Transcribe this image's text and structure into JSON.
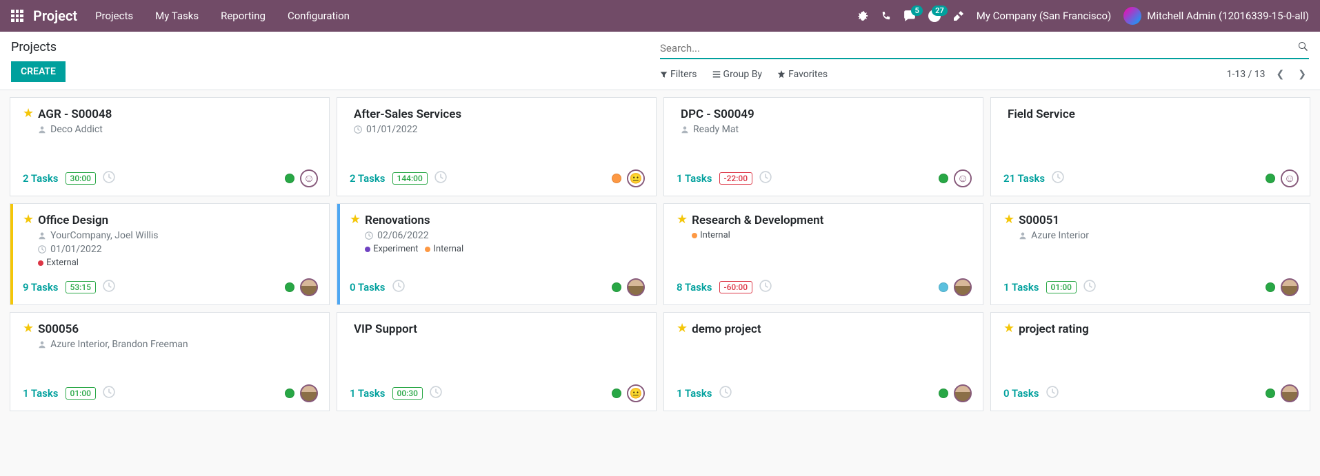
{
  "header": {
    "brand": "Project",
    "nav": [
      "Projects",
      "My Tasks",
      "Reporting",
      "Configuration"
    ],
    "chat_badge": "5",
    "activity_badge": "27",
    "company": "My Company (San Francisco)",
    "user": "Mitchell Admin (12016339-15-0-all)"
  },
  "control": {
    "breadcrumb": "Projects",
    "create_label": "CREATE",
    "search_placeholder": "Search...",
    "filters_label": "Filters",
    "groupby_label": "Group By",
    "favorites_label": "Favorites",
    "pager": "1-13 / 13"
  },
  "tag_colors": {
    "External": "#dc3545",
    "Experiment": "#6f42c1",
    "Internal": "#fd9843"
  },
  "cards": [
    {
      "star": true,
      "stripe": null,
      "title": "AGR - S00048",
      "partner": "Deco Addict",
      "date": null,
      "tags": [],
      "tasks": "2 Tasks",
      "pill": "30:00",
      "pill_color": "green",
      "status": "green",
      "avatar": "smiley"
    },
    {
      "star": false,
      "stripe": null,
      "title": "After-Sales Services",
      "partner": null,
      "date": "01/01/2022",
      "tags": [],
      "tasks": "2 Tasks",
      "pill": "144:00",
      "pill_color": "green",
      "status": "orange",
      "avatar": "neutral"
    },
    {
      "star": false,
      "stripe": null,
      "title": "DPC - S00049",
      "partner": "Ready Mat",
      "date": null,
      "tags": [],
      "tasks": "1 Tasks",
      "pill": "-22:00",
      "pill_color": "red",
      "status": "green",
      "avatar": "smiley"
    },
    {
      "star": false,
      "stripe": null,
      "title": "Field Service",
      "partner": null,
      "date": null,
      "tags": [],
      "tasks": "21 Tasks",
      "pill": null,
      "pill_color": null,
      "status": "green",
      "avatar": "smiley"
    },
    {
      "star": true,
      "stripe": "yellow",
      "title": "Office Design",
      "partner": "YourCompany, Joel Willis",
      "date": "01/01/2022",
      "tags": [
        "External"
      ],
      "tasks": "9 Tasks",
      "pill": "53:15",
      "pill_color": "green",
      "status": "green",
      "avatar": "face"
    },
    {
      "star": true,
      "stripe": "blue",
      "title": "Renovations",
      "partner": null,
      "date": "02/06/2022",
      "tags": [
        "Experiment",
        "Internal"
      ],
      "tasks": "0 Tasks",
      "pill": null,
      "pill_color": null,
      "status": "green",
      "avatar": "face"
    },
    {
      "star": true,
      "stripe": null,
      "title": "Research & Development",
      "partner": null,
      "date": null,
      "tags": [
        "Internal"
      ],
      "tasks": "8 Tasks",
      "pill": "-60:00",
      "pill_color": "red",
      "status": "blue",
      "avatar": "face"
    },
    {
      "star": true,
      "stripe": null,
      "title": "S00051",
      "partner": "Azure Interior",
      "date": null,
      "tags": [],
      "tasks": "1 Tasks",
      "pill": "01:00",
      "pill_color": "green",
      "status": "green",
      "avatar": "face"
    },
    {
      "star": true,
      "stripe": null,
      "title": "S00056",
      "partner": "Azure Interior, Brandon Freeman",
      "date": null,
      "tags": [],
      "tasks": "1 Tasks",
      "pill": "01:00",
      "pill_color": "green",
      "status": "green",
      "avatar": "face"
    },
    {
      "star": false,
      "stripe": null,
      "title": "VIP Support",
      "partner": null,
      "date": null,
      "tags": [],
      "tasks": "1 Tasks",
      "pill": "00:30",
      "pill_color": "green",
      "status": "green",
      "avatar": "neutral"
    },
    {
      "star": true,
      "stripe": null,
      "title": "demo project",
      "partner": null,
      "date": null,
      "tags": [],
      "tasks": "1 Tasks",
      "pill": null,
      "pill_color": null,
      "status": "green",
      "avatar": "face"
    },
    {
      "star": true,
      "stripe": null,
      "title": "project rating",
      "partner": null,
      "date": null,
      "tags": [],
      "tasks": "0 Tasks",
      "pill": null,
      "pill_color": null,
      "status": "green",
      "avatar": "face"
    }
  ]
}
